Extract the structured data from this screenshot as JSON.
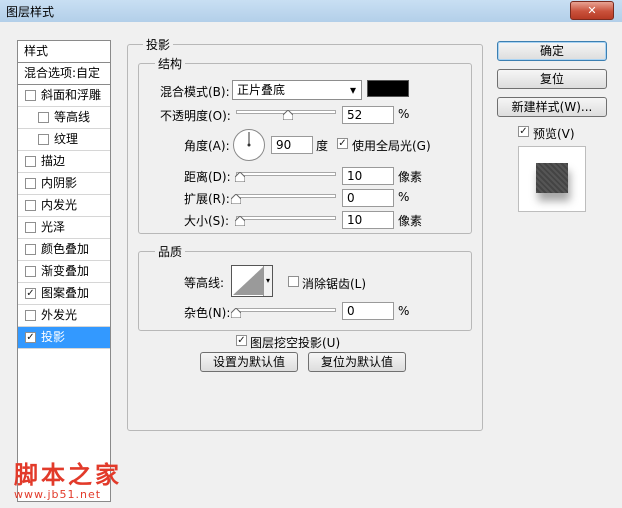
{
  "window": {
    "title": "图层样式",
    "close_icon": "✕"
  },
  "left_panel": {
    "header": "样式",
    "blend_options": "混合选项:自定",
    "items": [
      {
        "label": "斜面和浮雕",
        "checked": false
      },
      {
        "label": "等高线",
        "checked": false
      },
      {
        "label": "纹理",
        "checked": false
      },
      {
        "label": "描边",
        "checked": false
      },
      {
        "label": "内阴影",
        "checked": false
      },
      {
        "label": "内发光",
        "checked": false
      },
      {
        "label": "光泽",
        "checked": false
      },
      {
        "label": "颜色叠加",
        "checked": false
      },
      {
        "label": "渐变叠加",
        "checked": false
      },
      {
        "label": "图案叠加",
        "checked": true
      },
      {
        "label": "外发光",
        "checked": false
      },
      {
        "label": "投影",
        "checked": true,
        "selected": true
      }
    ]
  },
  "drop_shadow": {
    "section_title": "投影",
    "structure": {
      "title": "结构",
      "blend_mode_label": "混合模式(B):",
      "blend_mode_value": "正片叠底",
      "shadow_color": "#000000",
      "opacity_label": "不透明度(O):",
      "opacity_value": "52",
      "opacity_unit": "%",
      "opacity_level": 52,
      "angle_label": "角度(A):",
      "angle_value": "90",
      "angle_unit": "度",
      "global_light_label": "使用全局光(G)",
      "global_light_checked": true,
      "distance_label": "距离(D):",
      "distance_value": "10",
      "distance_unit": "像素",
      "distance_level": 4,
      "spread_label": "扩展(R):",
      "spread_value": "0",
      "spread_unit": "%",
      "spread_level": 0,
      "size_label": "大小(S):",
      "size_value": "10",
      "size_unit": "像素",
      "size_level": 4
    },
    "quality": {
      "title": "品质",
      "contour_label": "等高线:",
      "anti_alias_label": "消除锯齿(L)",
      "anti_alias_checked": false,
      "noise_label": "杂色(N):",
      "noise_value": "0",
      "noise_unit": "%",
      "noise_level": 0
    },
    "knockout_label": "图层挖空投影(U)",
    "knockout_checked": true,
    "make_default": "设置为默认值",
    "reset_default": "复位为默认值"
  },
  "right_buttons": {
    "ok": "确定",
    "reset": "复位",
    "new_style": "新建样式(W)...",
    "preview_label": "预览(V)",
    "preview_checked": true
  },
  "watermark": {
    "line1": "脚本之家",
    "line2": "www.jb51.net"
  },
  "colors": {
    "selection": "#3399ff",
    "titlebar": "#b3cfe9",
    "close": "#c9513b",
    "watermark": "#e23a2a"
  }
}
